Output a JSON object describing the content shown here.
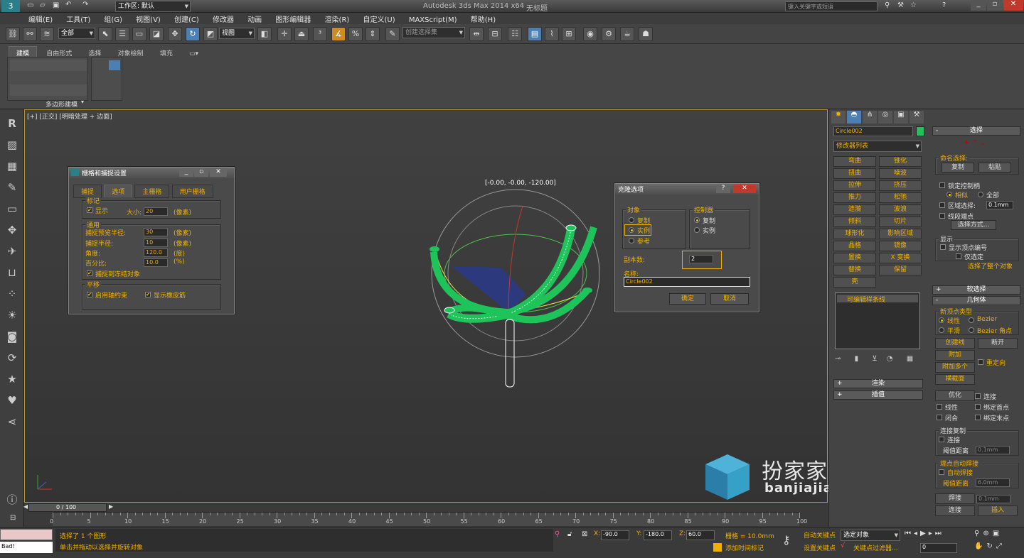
{
  "app": {
    "title": "Autodesk 3ds Max  2014 x64",
    "file": "无标题",
    "workspace_label": "工作区: 默认",
    "search_placeholder": "键入关键字或短语"
  },
  "menu": [
    "编辑(E)",
    "工具(T)",
    "组(G)",
    "视图(V)",
    "创建(C)",
    "修改器",
    "动画",
    "图形编辑器",
    "渲染(R)",
    "自定义(U)",
    "MAXScript(M)",
    "帮助(H)"
  ],
  "toolbar": {
    "filter_value": "全部",
    "refcoord_value": "视图",
    "selection_set_placeholder": "创建选择集"
  },
  "ribbon": {
    "tabs": [
      "建模",
      "自由形式",
      "选择",
      "对象绘制",
      "填充"
    ],
    "panel_label": "多边形建模"
  },
  "viewport": {
    "label": "[+] [正交] [明暗处理 + 边面]",
    "coord_readout": "[-0.00, -0.00, -120.00]"
  },
  "grid_dialog": {
    "title": "栅格和捕捉设置",
    "tabs": [
      "捕捉",
      "选项",
      "主栅格",
      "用户栅格"
    ],
    "markers_group": "标记",
    "show_label": "显示",
    "size_label": "大小:",
    "size_value": "20",
    "pixel_unit": "(像素)",
    "general_group": "通用",
    "preview_radius_label": "捕捉预览半径:",
    "preview_radius_value": "30",
    "snap_radius_label": "捕捉半径:",
    "snap_radius_value": "10",
    "angle_label": "角度:",
    "angle_value": "120.0",
    "angle_unit": "(度)",
    "percent_label": "百分比:",
    "percent_value": "10.0",
    "percent_unit": "(%)",
    "frozen_label": "捕捉到冻结对象",
    "translate_group": "平移",
    "axis_constraint_label": "启用轴约束",
    "rubber_band_label": "显示橡皮筋"
  },
  "clone_dialog": {
    "title": "克隆选项",
    "object_group": "对象",
    "controller_group": "控制器",
    "copy_label": "复制",
    "instance_label": "实例",
    "reference_label": "参考",
    "ctrl_copy_label": "复制",
    "ctrl_instance_label": "实例",
    "copies_label": "副本数:",
    "copies_value": "2",
    "name_label": "名称:",
    "name_value": "Circle002",
    "ok_label": "确定",
    "cancel_label": "取消"
  },
  "command_panel": {
    "object_name": "Circle002",
    "modifier_list": "修改器列表",
    "modifiers": [
      "弯曲",
      "锥化",
      "扭曲",
      "噪波",
      "拉伸",
      "挤压",
      "推力",
      "松弛",
      "涟漪",
      "波浪",
      "倾斜",
      "切片",
      "球形化",
      "影响区域",
      "晶格",
      "镜像",
      "置换",
      "X 变换",
      "替换",
      "保留",
      "壳"
    ],
    "stack_item": "可编辑样条线",
    "render_rollout": "渲染",
    "interp_rollout": "插值"
  },
  "roll_panel": {
    "selection_header": "选择",
    "named_sel_label": "命名选择:",
    "copy_btn": "复制",
    "paste_btn": "粘贴",
    "lock_handles": "锁定控制柄",
    "similar": "相似",
    "all": "全部",
    "area_sel": "区域选择:",
    "area_value": "0.1mm",
    "seg_end": "线段端点",
    "sel_method_btn": "选择方式...",
    "display_label": "显示",
    "show_vertex_num": "显示顶点编号",
    "only_selected": "仅选定",
    "selected_whole": "选择了整个对象",
    "soft_sel_header": "软选择",
    "geometry_header": "几何体",
    "new_vertex_type": "新顶点类型",
    "linear": "线性",
    "bezier": "Bezier",
    "smooth": "平滑",
    "bezier_corner": "Bezier 角点",
    "create_line": "创建线",
    "break_btn": "断开",
    "attach_btn": "附加",
    "attach_multi": "附加多个",
    "reorient": "重定向",
    "cross_section": "横截面",
    "optimize": "优化",
    "connect_chk": "连接",
    "linear_chk": "线性",
    "bind_first": "绑定首点",
    "closed_chk": "闭合",
    "bind_last": "绑定末点",
    "conn_copy": "连接复制",
    "conn_chk": "连接",
    "threshold_label": "阈值距离",
    "threshold_value": "0.1mm",
    "endpoint_weld": "端点自动焊接",
    "auto_weld": "自动焊接",
    "weld_threshold": "6.0mm",
    "weld_btn": "焊接",
    "weld_value": "0.1mm",
    "connect_btn": "连接",
    "insert_btn": "插入"
  },
  "timeline": {
    "frame_label": "0 / 100",
    "ticks": [
      "0",
      "5",
      "10",
      "15",
      "20",
      "25",
      "30",
      "35",
      "40",
      "45",
      "50",
      "55",
      "60",
      "65",
      "70",
      "75",
      "80",
      "85",
      "90",
      "95",
      "100"
    ]
  },
  "status": {
    "script_text": "Bad!",
    "line1": "选择了 1 个图形",
    "line2": "单击并拖动以选择并旋转对象",
    "x_value": "-90.0",
    "y_value": "-180.0",
    "z_value": "60.0",
    "grid_label": "栅格 = 10.0mm",
    "auto_key": "自动关键点",
    "set_key": "设置关键点",
    "selected_obj": "选定对象",
    "key_filter": "关键点过滤器...",
    "add_time_tag": "添加时间标记",
    "frame_value": "0"
  },
  "watermark": {
    "title": "扮家家室内设计",
    "url": "banjiajia.com"
  },
  "colors": {
    "accent_orange": "#f0b000",
    "highlight_blue": "#4d7fb3",
    "object_color": "#1ec35a",
    "viewport_border": "#b59a3a"
  }
}
